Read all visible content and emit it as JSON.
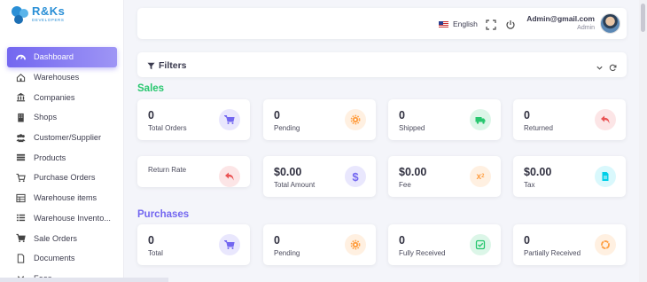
{
  "brand": {
    "title": "R&Ks",
    "subtitle": "DEVELOPERS"
  },
  "sidebar": {
    "items": [
      {
        "label": "Dashboard",
        "icon": "dashboard-icon",
        "active": true
      },
      {
        "label": "Warehouses",
        "icon": "home-icon"
      },
      {
        "label": "Companies",
        "icon": "bank-icon"
      },
      {
        "label": "Shops",
        "icon": "building-icon"
      },
      {
        "label": "Customer/Supplier",
        "icon": "users-icon"
      },
      {
        "label": "Products",
        "icon": "layers-icon"
      },
      {
        "label": "Purchase Orders",
        "icon": "cart-icon"
      },
      {
        "label": "Warehouse items",
        "icon": "table-icon"
      },
      {
        "label": "Warehouse Invento...",
        "icon": "list-icon"
      },
      {
        "label": "Sale Orders",
        "icon": "cart-icon"
      },
      {
        "label": "Documents",
        "icon": "document-icon"
      },
      {
        "label": "Fees",
        "icon": "chevron-down-icon"
      }
    ]
  },
  "header": {
    "language": "English",
    "user_name": "Admin@gmail.com",
    "user_role": "Admin"
  },
  "filters": {
    "title": "Filters"
  },
  "sales": {
    "title": "Sales",
    "cards": [
      {
        "value": "0",
        "label": "Total Orders",
        "icon": "cart-icon"
      },
      {
        "value": "0",
        "label": "Pending",
        "icon": "gear-icon"
      },
      {
        "value": "0",
        "label": "Shipped",
        "icon": "truck-icon"
      },
      {
        "value": "0",
        "label": "Returned",
        "icon": "return-icon"
      },
      {
        "value": "",
        "label": "Return Rate",
        "icon": "return-icon"
      },
      {
        "value": "$0.00",
        "label": "Total Amount",
        "icon": "dollar-icon"
      },
      {
        "value": "$0.00",
        "label": "Fee",
        "icon": "x2-icon"
      },
      {
        "value": "$0.00",
        "label": "Tax",
        "icon": "file-icon"
      }
    ]
  },
  "purchases": {
    "title": "Purchases",
    "cards": [
      {
        "value": "0",
        "label": "Total",
        "icon": "cart-icon"
      },
      {
        "value": "0",
        "label": "Pending",
        "icon": "gear-icon"
      },
      {
        "value": "0",
        "label": "Fully Received",
        "icon": "check-icon"
      },
      {
        "value": "0",
        "label": "Partially Received",
        "icon": "circle-icon"
      }
    ]
  },
  "colors": {
    "accent": "#7367f0",
    "sales_title": "#28c76f",
    "purchases_title": "#7367f0",
    "purple": "#7367f0",
    "orange": "#ff9f43",
    "green": "#28c76f",
    "red": "#ea5455",
    "cyan": "#00cfe8"
  }
}
